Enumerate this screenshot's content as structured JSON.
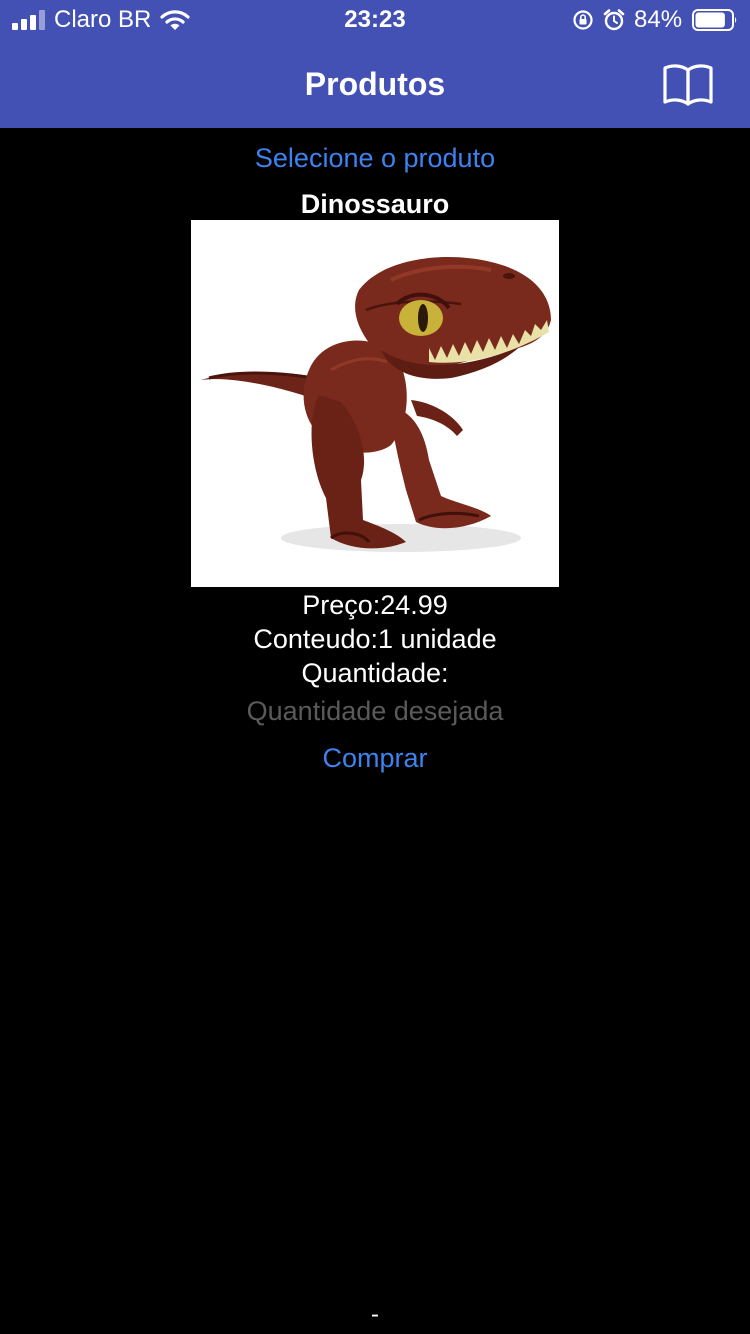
{
  "status_bar": {
    "carrier": "Claro BR",
    "time": "23:23",
    "battery_percent": "84%",
    "battery_level": 0.84,
    "icons": [
      "signal-icon",
      "wifi-icon",
      "orientation-lock-icon",
      "alarm-icon",
      "battery-icon"
    ]
  },
  "nav": {
    "title": "Produtos",
    "right_icon": "book-icon"
  },
  "product": {
    "select_label": "Selecione o produto",
    "name": "Dinossauro",
    "image": "dinosaur-toy-image",
    "price_line": "Preço:24.99",
    "content_line": "Conteudo:1 unidade",
    "quantity_label": "Quantidade:",
    "quantity_value": "",
    "quantity_placeholder": "Quantidade desejada",
    "buy_label": "Comprar"
  },
  "footer": {
    "dash": "-"
  },
  "colors": {
    "nav_background": "#4451b4",
    "background": "#000000",
    "link": "#3d82f0",
    "text": "#ffffff",
    "placeholder": "#5a5a5a"
  }
}
